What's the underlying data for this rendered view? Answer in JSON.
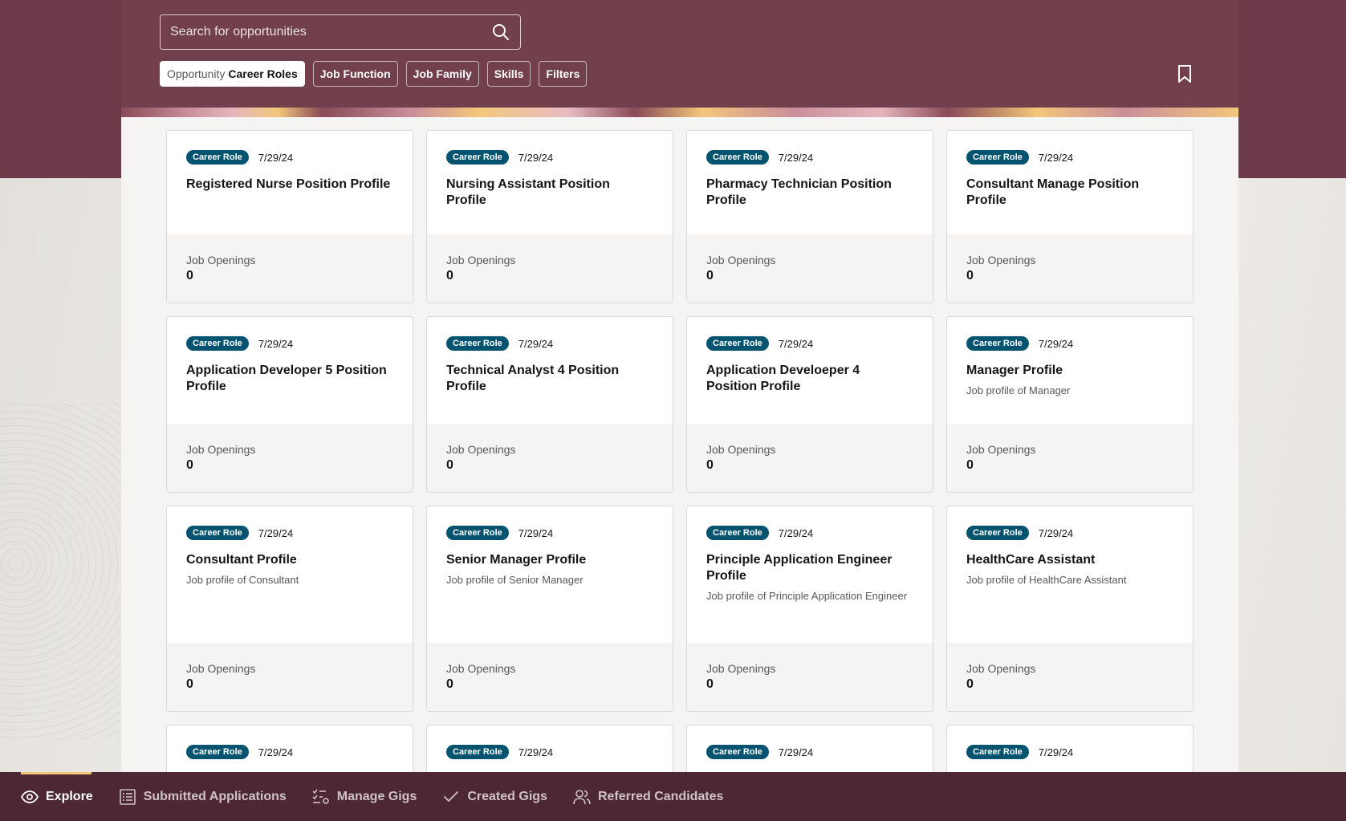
{
  "search": {
    "placeholder": "Search for opportunities"
  },
  "filters": {
    "active_prefix": "Opportunity",
    "active_label": "Career Roles",
    "chips": [
      {
        "label": "Job Function"
      },
      {
        "label": "Job Family"
      },
      {
        "label": "Skills"
      },
      {
        "label": "Filters"
      }
    ]
  },
  "icons": {
    "search": "search-icon",
    "bookmark": "bookmark-icon"
  },
  "colors": {
    "header": "#723f4c",
    "badge": "#04536f",
    "nav": "#4e2734",
    "accent": "#f2c87a"
  },
  "cards": [
    {
      "badge": "Career Role",
      "date": "7/29/24",
      "title": "Registered Nurse Position Profile",
      "description": "",
      "openings_label": "Job Openings",
      "openings": "0"
    },
    {
      "badge": "Career Role",
      "date": "7/29/24",
      "title": "Nursing Assistant Position Profile",
      "description": "",
      "openings_label": "Job Openings",
      "openings": "0"
    },
    {
      "badge": "Career Role",
      "date": "7/29/24",
      "title": "Pharmacy Technician Position Profile",
      "description": "",
      "openings_label": "Job Openings",
      "openings": "0"
    },
    {
      "badge": "Career Role",
      "date": "7/29/24",
      "title": "Consultant Manage Position Profile",
      "description": "",
      "openings_label": "Job Openings",
      "openings": "0"
    },
    {
      "badge": "Career Role",
      "date": "7/29/24",
      "title": "Application Developer 5 Position Profile",
      "description": "",
      "openings_label": "Job Openings",
      "openings": "0"
    },
    {
      "badge": "Career Role",
      "date": "7/29/24",
      "title": "Technical Analyst 4 Position Profile",
      "description": "",
      "openings_label": "Job Openings",
      "openings": "0"
    },
    {
      "badge": "Career Role",
      "date": "7/29/24",
      "title": "Application Develoeper 4 Position Profile",
      "description": "",
      "openings_label": "Job Openings",
      "openings": "0"
    },
    {
      "badge": "Career Role",
      "date": "7/29/24",
      "title": "Manager Profile",
      "description": "Job profile of Manager",
      "openings_label": "Job Openings",
      "openings": "0"
    },
    {
      "badge": "Career Role",
      "date": "7/29/24",
      "title": "Consultant Profile",
      "description": "Job profile of Consultant",
      "openings_label": "Job Openings",
      "openings": "0"
    },
    {
      "badge": "Career Role",
      "date": "7/29/24",
      "title": "Senior Manager Profile",
      "description": "Job profile of Senior Manager",
      "openings_label": "Job Openings",
      "openings": "0"
    },
    {
      "badge": "Career Role",
      "date": "7/29/24",
      "title": "Principle Application Engineer Profile",
      "description": "Job profile of Principle Application Engineer",
      "openings_label": "Job Openings",
      "openings": "0"
    },
    {
      "badge": "Career Role",
      "date": "7/29/24",
      "title": "HealthCare Assistant",
      "description": "Job profile of HealthCare Assistant",
      "openings_label": "Job Openings",
      "openings": "0"
    },
    {
      "badge": "Career Role",
      "date": "7/29/24"
    },
    {
      "badge": "Career Role",
      "date": "7/29/24"
    },
    {
      "badge": "Career Role",
      "date": "7/29/24"
    },
    {
      "badge": "Career Role",
      "date": "7/29/24"
    }
  ],
  "bottom_nav": [
    {
      "label": "Explore",
      "icon": "eye-icon",
      "active": true
    },
    {
      "label": "Submitted Applications",
      "icon": "list-icon"
    },
    {
      "label": "Manage Gigs",
      "icon": "checklist-gear-icon"
    },
    {
      "label": "Created Gigs",
      "icon": "checkmark-icon"
    },
    {
      "label": "Referred Candidates",
      "icon": "people-icon"
    }
  ]
}
